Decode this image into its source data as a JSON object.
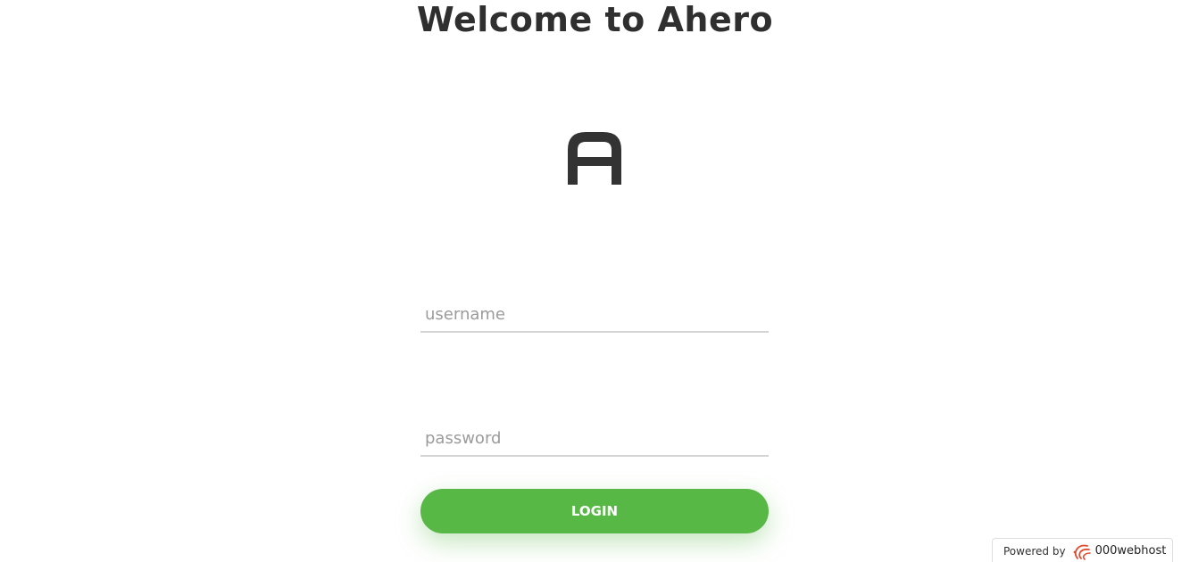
{
  "page": {
    "title": "Welcome to Ahero"
  },
  "logo": {
    "icon": "ahero-logo-icon",
    "color": "#333333"
  },
  "form": {
    "username": {
      "value": "",
      "placeholder": "username"
    },
    "password": {
      "value": "",
      "placeholder": "password"
    },
    "login_label": "LOGIN"
  },
  "footer": {
    "powered_by": "Powered by",
    "brand": "000webhost",
    "brand_icon": "000webhost-logo-icon"
  },
  "colors": {
    "accent": "#57b846",
    "title": "#2f2f2f",
    "brand_icon": "#e04b2f"
  }
}
